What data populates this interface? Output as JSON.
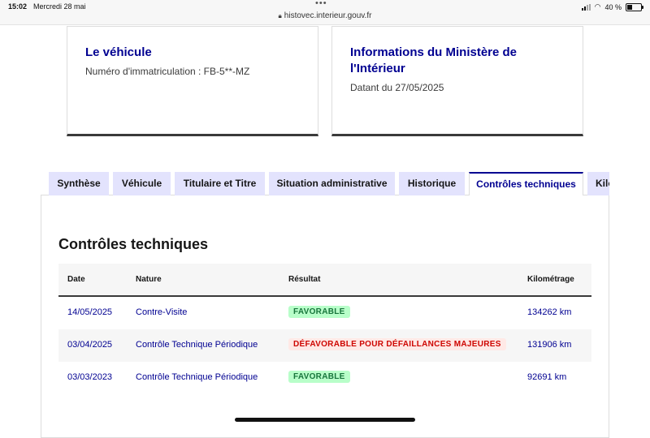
{
  "status_bar": {
    "time": "15:02",
    "date": "Mercredi 28 mai",
    "url": "histovec.interieur.gouv.fr",
    "battery": "40 %",
    "battery_level": 0.4
  },
  "cards": [
    {
      "title": "Le véhicule",
      "subtitle": "Numéro d'immatriculation : FB-5**-MZ"
    },
    {
      "title": "Informations du Ministère de l'Intérieur",
      "subtitle": "Datant du 27/05/2025"
    }
  ],
  "tabs": [
    {
      "label": "Synthèse"
    },
    {
      "label": "Véhicule"
    },
    {
      "label": "Titulaire et Titre"
    },
    {
      "label": "Situation administrative"
    },
    {
      "label": "Historique"
    },
    {
      "label": "Contrôles techniques",
      "active": true
    },
    {
      "label": "Kilométrage"
    }
  ],
  "section": {
    "title": "Contrôles techniques",
    "columns": [
      "Date",
      "Nature",
      "Résultat",
      "Kilométrage"
    ],
    "rows": [
      {
        "date": "14/05/2025",
        "nature": "Contre-Visite",
        "result": "FAVORABLE",
        "result_status": "favorable",
        "km": "134262 km"
      },
      {
        "date": "03/04/2025",
        "nature": "Contrôle Technique Périodique",
        "result": "DÉFAVORABLE POUR DÉFAILLANCES MAJEURES",
        "result_status": "defavorable",
        "km": "131906 km"
      },
      {
        "date": "03/03/2023",
        "nature": "Contrôle Technique Périodique",
        "result": "FAVORABLE",
        "result_status": "favorable",
        "km": "92691 km"
      }
    ]
  },
  "colors": {
    "primary": "#000091",
    "tab_bg": "#e3e3fd",
    "favorable_bg": "#b8fec9",
    "favorable_text": "#18753c",
    "defavorable_bg": "#ffe9e6",
    "defavorable_text": "#ce0500"
  }
}
